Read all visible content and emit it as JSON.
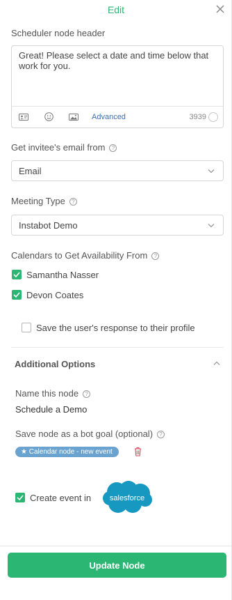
{
  "header": {
    "title": "Edit",
    "close_icon": "close-icon"
  },
  "scheduler_header": {
    "label": "Scheduler node header",
    "text": "Great! Please select a date and time below that work for you.",
    "toolbar": {
      "icons": [
        "contact-card-icon",
        "emoji-icon",
        "image-icon"
      ],
      "advanced_label": "Advanced",
      "char_count": "3939"
    }
  },
  "invitee_email": {
    "label": "Get invitee's email from",
    "selected": "Email"
  },
  "meeting_type": {
    "label": "Meeting Type",
    "selected": "Instabot Demo"
  },
  "calendars": {
    "label": "Calendars to Get Availability From",
    "items": [
      {
        "name": "Samantha Nasser",
        "checked": true
      },
      {
        "name": "Devon Coates",
        "checked": true
      }
    ]
  },
  "save_response": {
    "label": "Save the user's response to their profile",
    "checked": false
  },
  "additional_options": {
    "title": "Additional Options",
    "expanded": true,
    "node_name_label": "Name this node",
    "node_name_value": "Schedule a Demo",
    "bot_goal_label": "Save node as a bot goal (optional)",
    "bot_goal_tag": "Calendar node - new event",
    "create_event_label": "Create event in",
    "create_event_checked": true,
    "salesforce_logo_text": "salesforce"
  },
  "footer": {
    "update_button": "Update Node"
  },
  "colors": {
    "accent": "#2bb673",
    "link": "#3d6fb6",
    "tag": "#6aa3cf",
    "salesforce": "#1798c1",
    "danger": "#e0405e"
  }
}
